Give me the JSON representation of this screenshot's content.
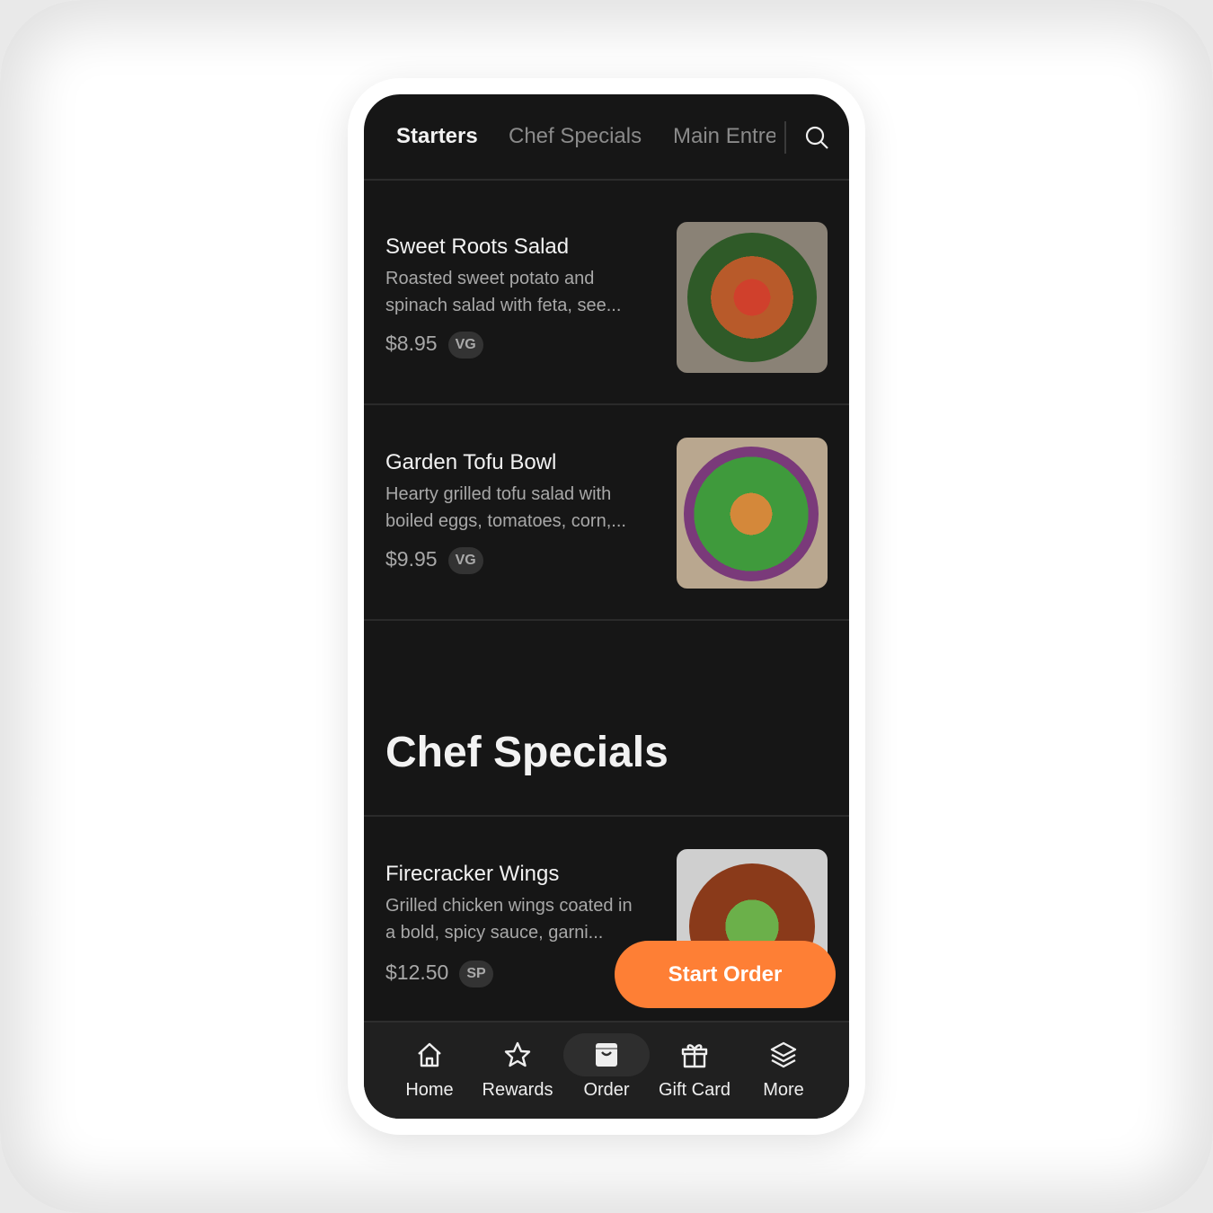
{
  "tabs": [
    {
      "label": "Starters",
      "active": true
    },
    {
      "label": "Chef Specials",
      "active": false
    },
    {
      "label": "Main Entre",
      "active": false
    }
  ],
  "search_icon": "search-icon",
  "items": [
    {
      "name": "Sweet Roots Salad",
      "desc": "Roasted sweet potato and spinach salad with feta, see...",
      "price": "$8.95",
      "badge": "VG"
    },
    {
      "name": "Garden Tofu Bowl",
      "desc": "Hearty grilled tofu salad with boiled eggs, tomatoes, corn,...",
      "price": "$9.95",
      "badge": "VG"
    },
    {
      "name": "Firecracker Wings",
      "desc": "Grilled chicken wings coated in a bold, spicy sauce, garni...",
      "price": "$12.50",
      "badge": "SP"
    }
  ],
  "section_title": "Chef Specials",
  "cta": "Start Order",
  "accent": "#fe7f35",
  "nav": [
    {
      "label": "Home",
      "icon": "home-icon"
    },
    {
      "label": "Rewards",
      "icon": "star-icon"
    },
    {
      "label": "Order",
      "icon": "bag-icon",
      "active": true
    },
    {
      "label": "Gift Card",
      "icon": "gift-icon"
    },
    {
      "label": "More",
      "icon": "layers-icon"
    }
  ]
}
